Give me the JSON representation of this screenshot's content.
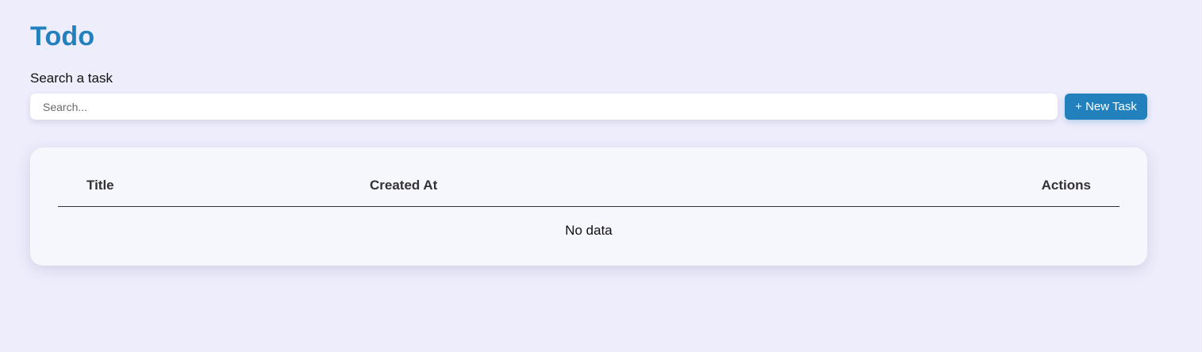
{
  "header": {
    "title": "Todo"
  },
  "search": {
    "label": "Search a task",
    "placeholder": "Search...",
    "value": ""
  },
  "actions": {
    "new_task_label": "+ New Task"
  },
  "table": {
    "columns": [
      "Title",
      "Created At",
      "Actions"
    ],
    "rows": [],
    "empty_message": "No data"
  },
  "colors": {
    "background": "#eeedfc",
    "accent": "#2281bd",
    "card": "#f6f6fd",
    "input": "#ffffff"
  }
}
